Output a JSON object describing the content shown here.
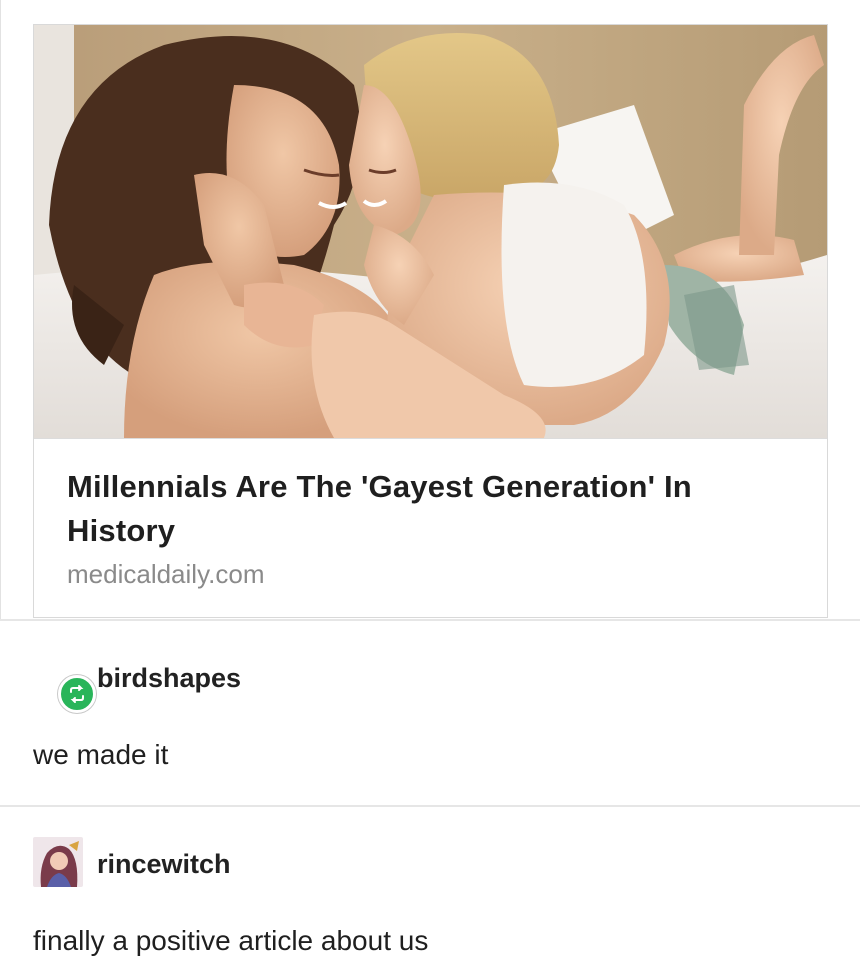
{
  "link_card": {
    "title": "Millennials Are The 'Gayest Generation' In History",
    "source": "medicaldaily.com"
  },
  "reblogs": [
    {
      "username": "birdshapes",
      "text": "we made it",
      "avatar_icon": "reblog-icon",
      "avatar_color": "#29b55a"
    },
    {
      "username": "rincewitch",
      "text": "finally a positive article about us",
      "avatar_icon": "avatar-illustration",
      "avatar_color": "#7a3b4a"
    }
  ]
}
